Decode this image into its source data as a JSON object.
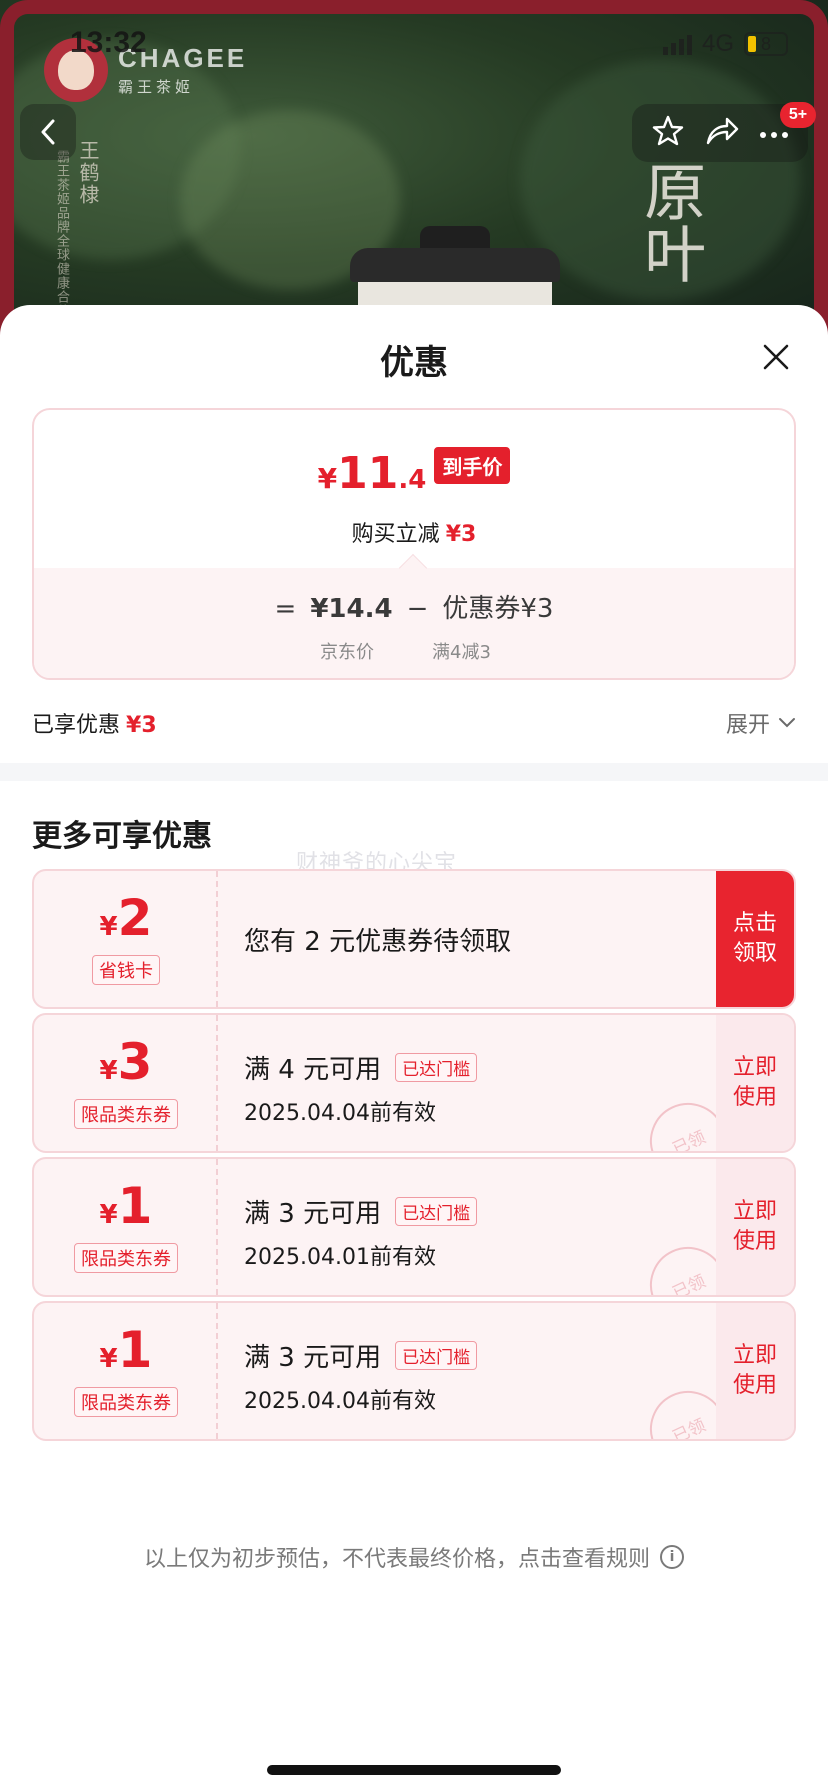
{
  "status_bar": {
    "time": "13:32",
    "network": "4G",
    "battery": "8"
  },
  "hero": {
    "brand_en": "CHAGEE",
    "brand_cn": "霸王茶姬",
    "vertical_name": "王鹤棣",
    "vertical_sub": "霸王茶姬品牌全球健康合伙",
    "big_chars": "原叶",
    "badge": "5+"
  },
  "sheet": {
    "title": "优惠",
    "final_price": {
      "currency": "¥",
      "integer": "11",
      "decimal": ".4",
      "tag": "到手价",
      "subtitle": "购买立减",
      "subtitle_amount": "¥3"
    },
    "formula": {
      "equals": "=",
      "jd_price": "¥14.4",
      "minus": "−",
      "coupon_label": "优惠券¥3",
      "jd_price_label": "京东价",
      "coupon_rule": "满4减3"
    },
    "enjoyed_label": "已享优惠",
    "enjoyed_amount": "¥3",
    "expand_label": "展开",
    "more_title": "更多可享优惠",
    "watermark": "财神爷的心尖宝",
    "coupons": [
      {
        "sym": "¥",
        "amount": "2",
        "type": "省钱卡",
        "text": "您有 2 元优惠券待领取",
        "action": "点击领取"
      },
      {
        "sym": "¥",
        "amount": "3",
        "type": "限品类东券",
        "condition": "满 4 元可用",
        "tag": "已达门槛",
        "valid": "2025.04.04前有效",
        "action": "立即使用",
        "stamp": "已领"
      },
      {
        "sym": "¥",
        "amount": "1",
        "type": "限品类东券",
        "condition": "满 3 元可用",
        "tag": "已达门槛",
        "valid": "2025.04.01前有效",
        "action": "立即使用",
        "stamp": "已领"
      },
      {
        "sym": "¥",
        "amount": "1",
        "type": "限品类东券",
        "condition": "满 3 元可用",
        "tag": "已达门槛",
        "valid": "2025.04.04前有效",
        "action": "立即使用",
        "stamp": "已领"
      }
    ],
    "disclaimer": "以上仅为初步预估，不代表最终价格，点击查看规则"
  },
  "colors": {
    "accent": "#e4202c",
    "coupon_bg": "#fdf3f4",
    "brand_frame": "#8a1f2c"
  }
}
